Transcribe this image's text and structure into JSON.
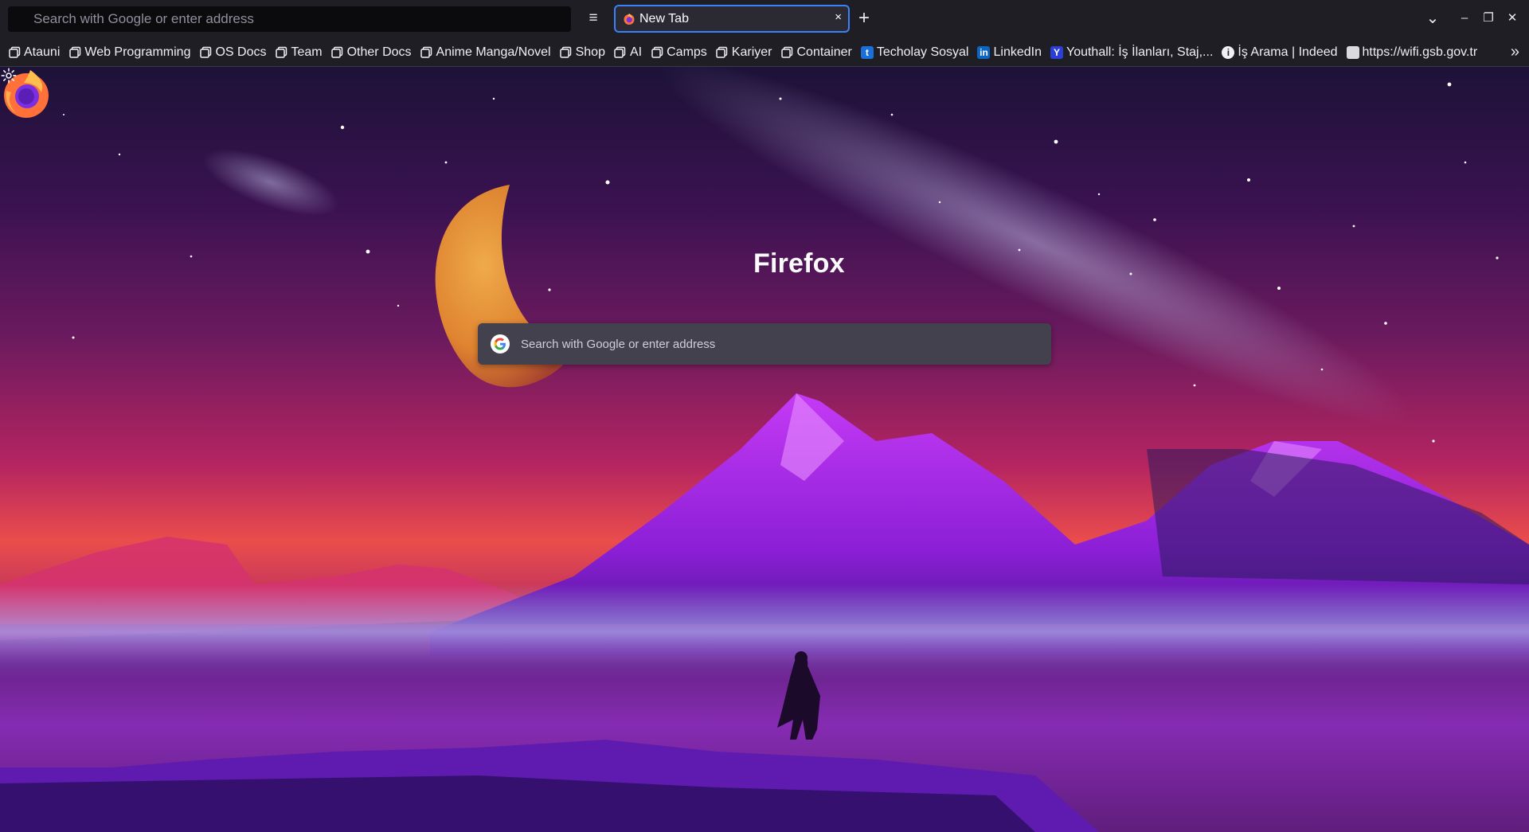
{
  "urlbar": {
    "placeholder": "Search with Google or enter address"
  },
  "toolbar": {
    "menu_icon": "hamburger-icon",
    "newtab_label": "+"
  },
  "tab": {
    "title": "New Tab",
    "close": "×",
    "favicon": "firefox-icon"
  },
  "window": {
    "list_tabs": "⌄",
    "minimize": "–",
    "restore": "❐",
    "close": "✕"
  },
  "bookmarks": [
    {
      "label": "Atauni",
      "icon": "folder-icon"
    },
    {
      "label": "Web Programming",
      "icon": "folder-icon"
    },
    {
      "label": "OS Docs",
      "icon": "folder-icon"
    },
    {
      "label": "Team",
      "icon": "folder-icon"
    },
    {
      "label": "Other Docs",
      "icon": "folder-icon"
    },
    {
      "label": "Anime Manga/Novel",
      "icon": "folder-icon"
    },
    {
      "label": "Shop",
      "icon": "folder-icon"
    },
    {
      "label": "AI",
      "icon": "folder-icon"
    },
    {
      "label": "Camps",
      "icon": "folder-icon"
    },
    {
      "label": "Kariyer",
      "icon": "folder-icon"
    },
    {
      "label": "Container",
      "icon": "folder-icon"
    },
    {
      "label": "Techolay Sosyal",
      "icon": "techolay-favicon",
      "tile": "t",
      "color": "#1a6fd8"
    },
    {
      "label": "LinkedIn",
      "icon": "linkedin-favicon",
      "tile": "in",
      "color": "#0a66c2"
    },
    {
      "label": "Youthall: İş İlanları, Staj,...",
      "icon": "youthall-favicon",
      "tile": "Y",
      "color": "#2b3fd6"
    },
    {
      "label": "İş Arama | Indeed",
      "icon": "info-icon",
      "tile": "i",
      "color": "#f0f0f4"
    },
    {
      "label": "https://wifi.gsb.gov.tr",
      "icon": "gsb-favicon",
      "tile": "",
      "color": "#d9d9e0"
    }
  ],
  "bookmarks_overflow": "»",
  "newtab": {
    "brand": "Firefox",
    "search_placeholder": "Search with Google or enter address",
    "settings_icon": "gear-icon"
  },
  "colors": {
    "accent": "#3b82f6",
    "chrome": "#1f1e25",
    "search_bg": "#42414d"
  }
}
